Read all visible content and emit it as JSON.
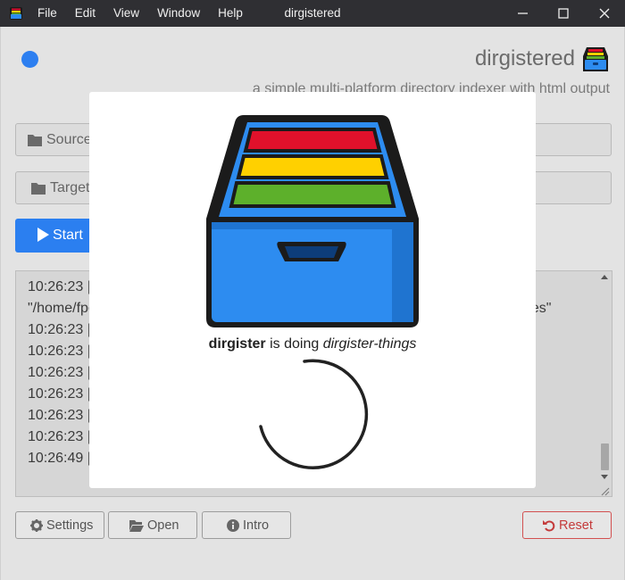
{
  "titlebar": {
    "title": "dirgistered",
    "menu": [
      "File",
      "Edit",
      "View",
      "Window",
      "Help"
    ],
    "icons": [
      "app-icon",
      "minimize-icon",
      "maximize-icon",
      "close-icon"
    ]
  },
  "header": {
    "app_name": "dirgistered",
    "subtitle": "a simple multi-platform directory indexer with html output",
    "status_color": "#2d7ff0"
  },
  "source": {
    "label": "Source",
    "icon": "folder-icon"
  },
  "target": {
    "label": "Target",
    "icon": "folder-icon"
  },
  "start": {
    "label": "Start",
    "icon": "play-icon",
    "color": "#2b7ff0"
  },
  "log": {
    "lines": [
      "10:26:23 |",
      "\"/home/fpo",
      "10:26:23 |",
      "10:26:23 |",
      "10:26:23 |",
      "10:26:23 |",
      "10:26:23 |",
      "10:26:23 |",
      "10:26:49 |"
    ],
    "tail_fragment": "ges\""
  },
  "footer": {
    "settings": "Settings",
    "open": "Open",
    "intro": "Intro",
    "reset": "Reset"
  },
  "modal": {
    "name": "dirgister",
    "middle": "is doing",
    "activity": "dirgister-things"
  },
  "colors": {
    "accent": "#2b7ff0",
    "danger": "#c43b3b",
    "drawer_blue": "#2d8cf0",
    "stripe_red": "#e0112b",
    "stripe_yellow": "#ffd000",
    "stripe_green": "#5db02b"
  }
}
